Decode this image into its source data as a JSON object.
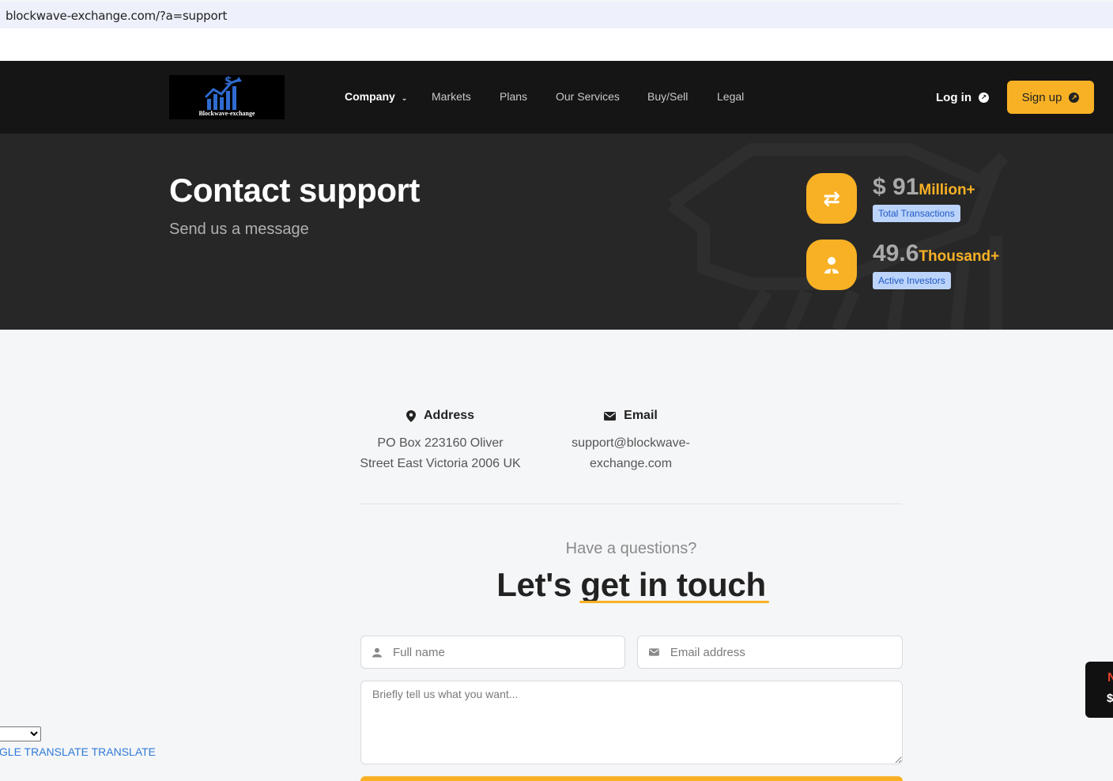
{
  "browser": {
    "url": "blockwave-exchange.com/?a=support"
  },
  "nav": {
    "logo_text": "Blockwave-exchange",
    "items": [
      {
        "label": "Company",
        "active": true,
        "has_dropdown": true
      },
      {
        "label": "Markets"
      },
      {
        "label": "Plans"
      },
      {
        "label": "Our Services"
      },
      {
        "label": "Buy/Sell"
      },
      {
        "label": "Legal"
      }
    ],
    "login_label": "Log in",
    "signup_label": "Sign up"
  },
  "hero": {
    "title": "Contact support",
    "subtitle": "Send us a message",
    "stats": [
      {
        "value": "$ 91",
        "unit": "Million+",
        "label": "Total Transactions",
        "icon": "exchange-icon"
      },
      {
        "value": "49.6",
        "unit": "Thousand+",
        "label": "Active Investors",
        "icon": "investor-icon"
      }
    ]
  },
  "contact": {
    "address": {
      "title": "Address",
      "line1": "PO Box 223160 Oliver",
      "line2": "Street East Victoria 2006 UK"
    },
    "email": {
      "title": "Email",
      "line1": "support@blockwave-",
      "line2": "exchange.com"
    }
  },
  "form": {
    "kicker": "Have a questions?",
    "heading_plain": "Let's",
    "heading_highlight": "get in touch",
    "name_placeholder": "Full name",
    "email_placeholder": "Email address",
    "message_placeholder": "Briefly tell us what you want..."
  },
  "translate": {
    "label": "OGLE TRANSLATE TRANSLATE"
  },
  "side_widget": {
    "line1": "N",
    "line2": "$"
  },
  "colors": {
    "accent": "#f8b125",
    "nav_bg": "#151515",
    "hero_bg": "#272727",
    "badge_bg": "#bcd3fa"
  }
}
